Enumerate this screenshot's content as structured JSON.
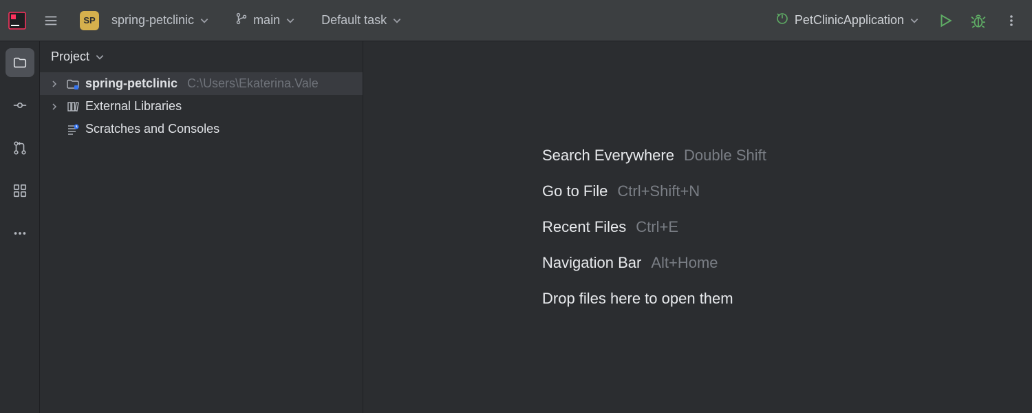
{
  "toolbar": {
    "project_badge": "SP",
    "project_name": "spring-petclinic",
    "branch_name": "main",
    "task_name": "Default task",
    "run_config": "PetClinicApplication"
  },
  "project_panel": {
    "title": "Project",
    "items": [
      {
        "label": "spring-petclinic",
        "path": "C:\\Users\\Ekaterina.Vale",
        "selected": true,
        "expandable": true
      },
      {
        "label": "External Libraries",
        "path": "",
        "selected": false,
        "expandable": true
      },
      {
        "label": "Scratches and Consoles",
        "path": "",
        "selected": false,
        "expandable": false
      }
    ]
  },
  "editor_tips": [
    {
      "action": "Search Everywhere",
      "shortcut": "Double Shift"
    },
    {
      "action": "Go to File",
      "shortcut": "Ctrl+Shift+N"
    },
    {
      "action": "Recent Files",
      "shortcut": "Ctrl+E"
    },
    {
      "action": "Navigation Bar",
      "shortcut": "Alt+Home"
    },
    {
      "action": "Drop files here to open them",
      "shortcut": ""
    }
  ]
}
